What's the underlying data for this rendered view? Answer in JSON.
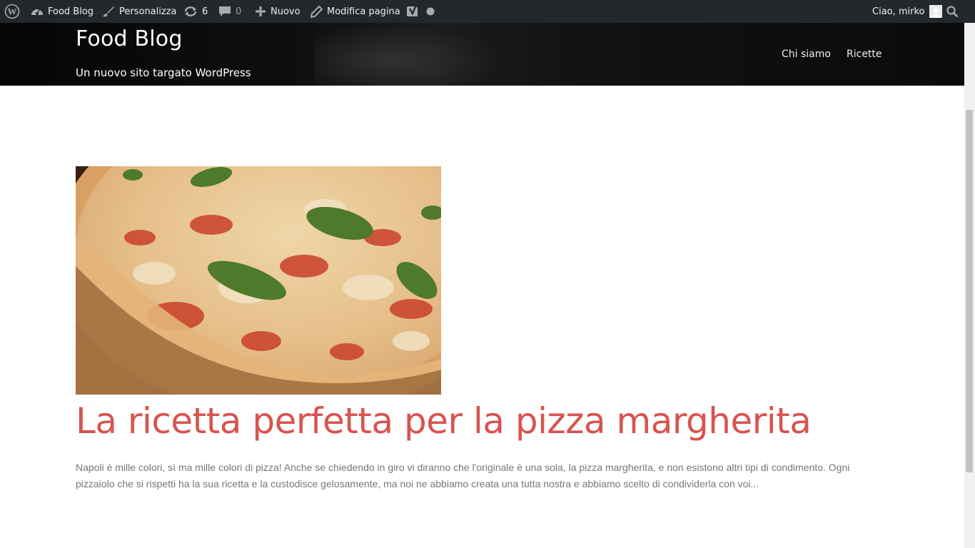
{
  "admin_bar": {
    "site_name": "Food Blog",
    "customize": "Personalizza",
    "updates_count": "6",
    "comments_count": "0",
    "new": "Nuovo",
    "edit_page": "Modifica pagina",
    "greeting": "Ciao, mirko",
    "icons": [
      "wordpress-logo-icon",
      "dashboard-icon",
      "brush-icon",
      "refresh-icon",
      "comment-icon",
      "plus-icon",
      "pencil-icon",
      "yoast-icon",
      "status-dot-icon",
      "avatar-icon",
      "search-icon"
    ]
  },
  "header": {
    "title": "Food Blog",
    "tagline": "Un nuovo sito targato WordPress",
    "nav": [
      "Chi siamo",
      "Ricette"
    ]
  },
  "post": {
    "title": "La ricetta perfetta per la pizza margherita",
    "excerpt": "Napoli è mille colori, sì ma mille colori di pizza! Anche se chiedendo in giro vi diranno che l'originale è una sola, la pizza margherita, e non esistono altri tipi di condimento. Ogni pizzaiolo che si rispetti ha la sua ricetta e la custodisce gelosamente, ma noi ne abbiamo creata una tutta nostra e abbiamo scelto di condividerla con voi...",
    "image": "pizza-margherita-photo"
  },
  "colors": {
    "admin_bar_bg": "#23282d",
    "header_bg": "#0a0a0a",
    "post_title": "#d9534f",
    "excerpt_text": "#777777"
  }
}
